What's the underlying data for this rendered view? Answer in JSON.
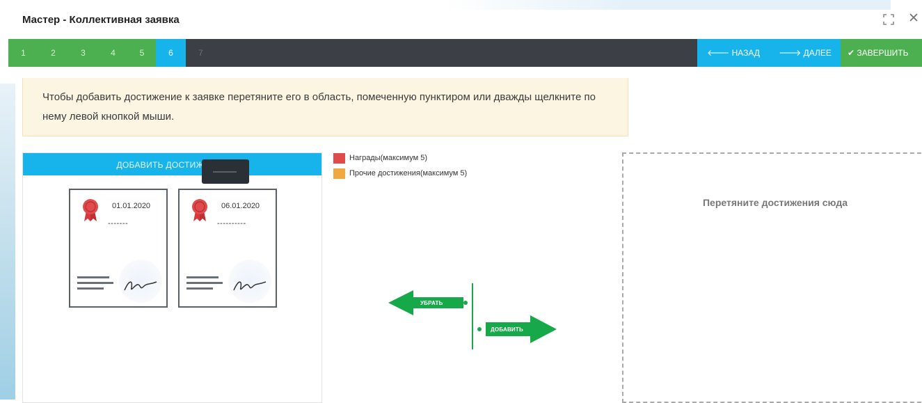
{
  "window": {
    "title": "Мастер - Коллективная заявка"
  },
  "steps": [
    {
      "label": "1",
      "state": "done"
    },
    {
      "label": "2",
      "state": "done"
    },
    {
      "label": "3",
      "state": "done"
    },
    {
      "label": "4",
      "state": "done"
    },
    {
      "label": "5",
      "state": "done"
    },
    {
      "label": "6",
      "state": "active"
    },
    {
      "label": "7",
      "state": "future"
    }
  ],
  "nav": {
    "back_label": "НАЗАД",
    "next_label": "ДАЛЕЕ",
    "finish_label": "ЗАВЕРШИТЬ"
  },
  "alert": {
    "text": "Чтобы добавить достижение к заявке перетяните его в область, помеченную пунктиром или дважды щелкните по нему левой кнопкой мыши."
  },
  "achievements_panel": {
    "header": "ДОБАВИТЬ ДОСТИЖЕНИЕ",
    "cards": [
      {
        "date": "01.01.2020",
        "name": "-------"
      },
      {
        "date": "06.01.2020",
        "name": "----------"
      }
    ]
  },
  "legend": [
    {
      "label": "Награды(максимум 5)",
      "color": "#e04a4a"
    },
    {
      "label": "Прочие достижения(максимум 5)",
      "color": "#f0a940"
    }
  ],
  "drop_area": {
    "text": "Перетяните достижения сюда"
  },
  "transfer": {
    "remove_label": "УБРАТЬ",
    "add_label": "ДОБАВИТЬ",
    "color": "#17a84a"
  },
  "colors": {
    "accent_blue": "#16b4ea",
    "accent_green": "#4caf50",
    "stepbar_dark": "#3c3f45"
  }
}
